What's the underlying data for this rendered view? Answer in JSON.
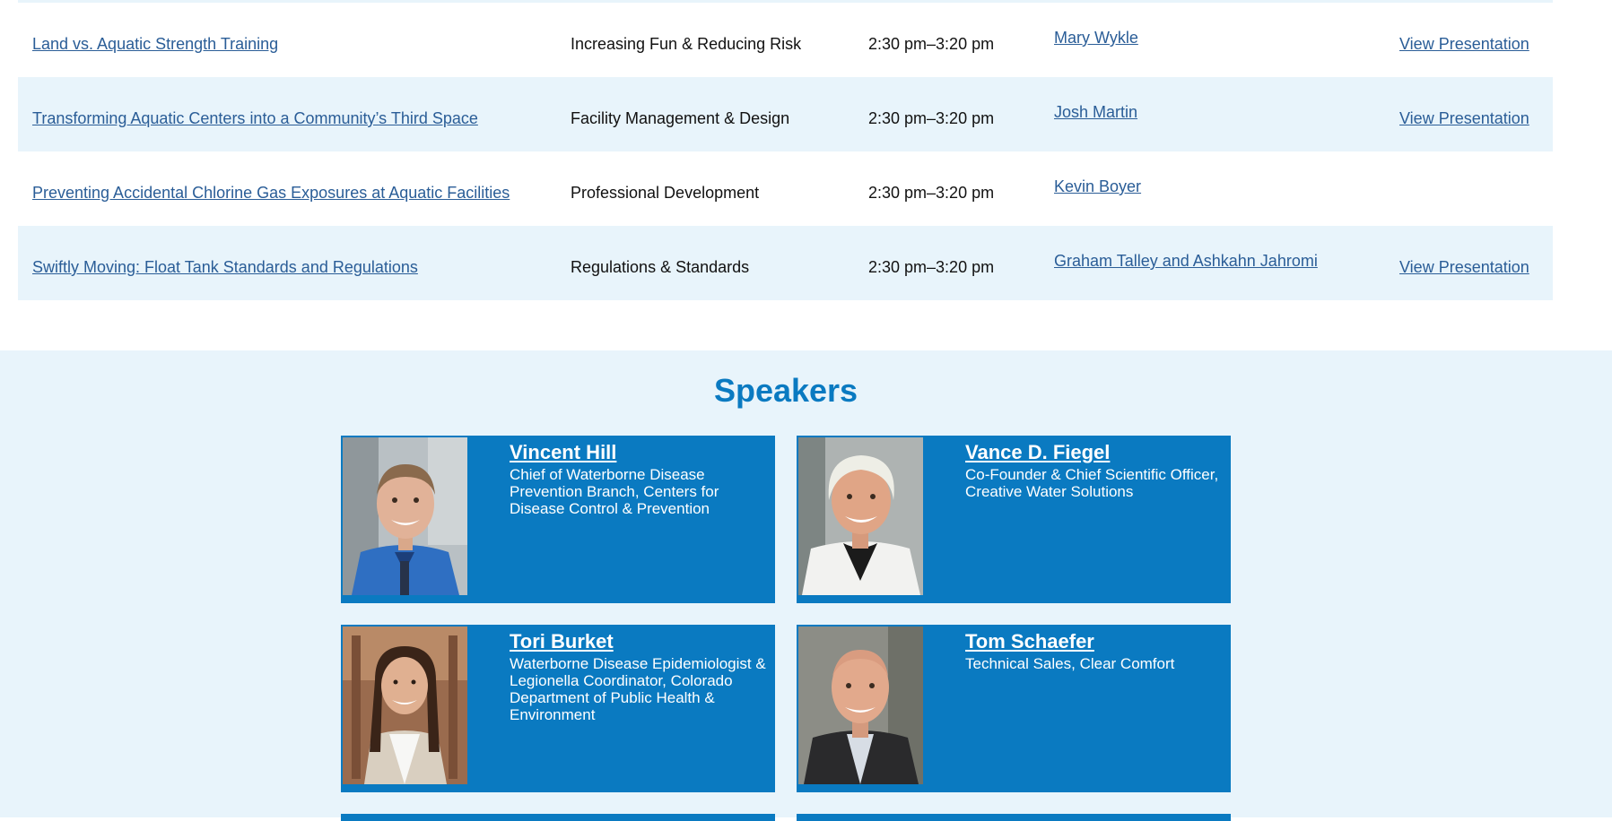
{
  "sessions": [
    {
      "title": "Land vs. Aquatic Strength Training",
      "track": "Increasing Fun & Reducing Risk",
      "time": "2:30 pm–3:20 pm",
      "speaker": "Mary Wykle",
      "action": "View Presentation"
    },
    {
      "title": "Transforming Aquatic Centers into a Community’s Third Space",
      "track": "Facility Management & Design",
      "time": "2:30 pm–3:20 pm",
      "speaker": "Josh Martin",
      "action": "View Presentation"
    },
    {
      "title": "Preventing Accidental Chlorine Gas Exposures at Aquatic Facilities",
      "track": "Professional Development",
      "time": "2:30 pm–3:20 pm",
      "speaker": "Kevin Boyer",
      "action": ""
    },
    {
      "title": "Swiftly Moving: Float Tank Standards and Regulations",
      "track": "Regulations & Standards",
      "time": "2:30 pm–3:20 pm",
      "speaker": "Graham Talley and Ashkahn Jahromi",
      "action": "View Presentation"
    }
  ],
  "speakers_heading": "Speakers",
  "speakers": [
    {
      "name": "Vincent Hill",
      "title": "Chief of Waterborne Disease Prevention Branch, Centers for Disease Control & Prevention"
    },
    {
      "name": "Vance D. Fiegel",
      "title": "Co-Founder & Chief Scientific Officer, Creative Water Solutions"
    },
    {
      "name": "Tori Burket",
      "title": "Waterborne Disease Epidemiologist & Legionella Coordinator, Colorado Department of Public Health & Environment"
    },
    {
      "name": "Tom Schaefer",
      "title": "Technical Sales, Clear Comfort"
    }
  ],
  "colors": {
    "accent": "#0a7ac1",
    "row_alt": "#e8f4fb",
    "link": "#2a5d97"
  }
}
